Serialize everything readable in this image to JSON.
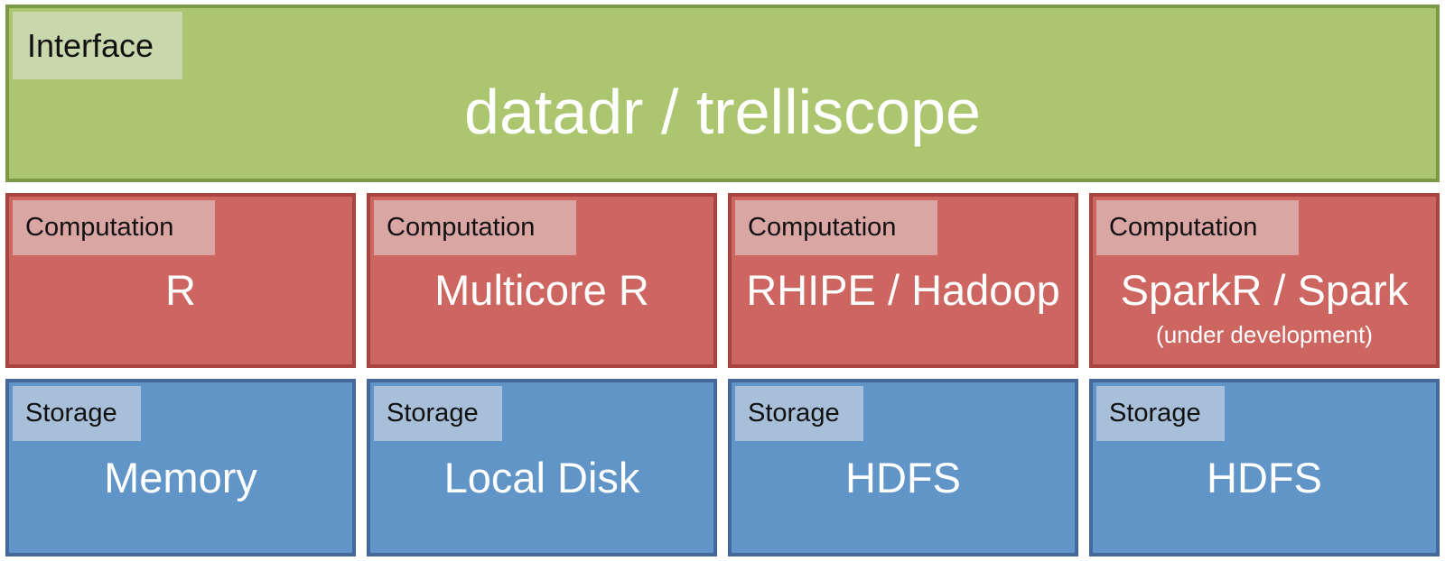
{
  "interface": {
    "tag": "Interface",
    "label": "datadr / trelliscope"
  },
  "computation": [
    {
      "tag": "Computation",
      "label": "R"
    },
    {
      "tag": "Computation",
      "label": "Multicore R"
    },
    {
      "tag": "Computation",
      "label": "RHIPE / Hadoop"
    },
    {
      "tag": "Computation",
      "label": "SparkR / Spark",
      "note": "(under development)"
    }
  ],
  "storage": [
    {
      "tag": "Storage",
      "label": "Memory"
    },
    {
      "tag": "Storage",
      "label": "Local Disk"
    },
    {
      "tag": "Storage",
      "label": "HDFS"
    },
    {
      "tag": "Storage",
      "label": "HDFS"
    }
  ],
  "colors": {
    "interface": "#abc66f",
    "computation": "#cd6560",
    "storage": "#6195c8"
  }
}
